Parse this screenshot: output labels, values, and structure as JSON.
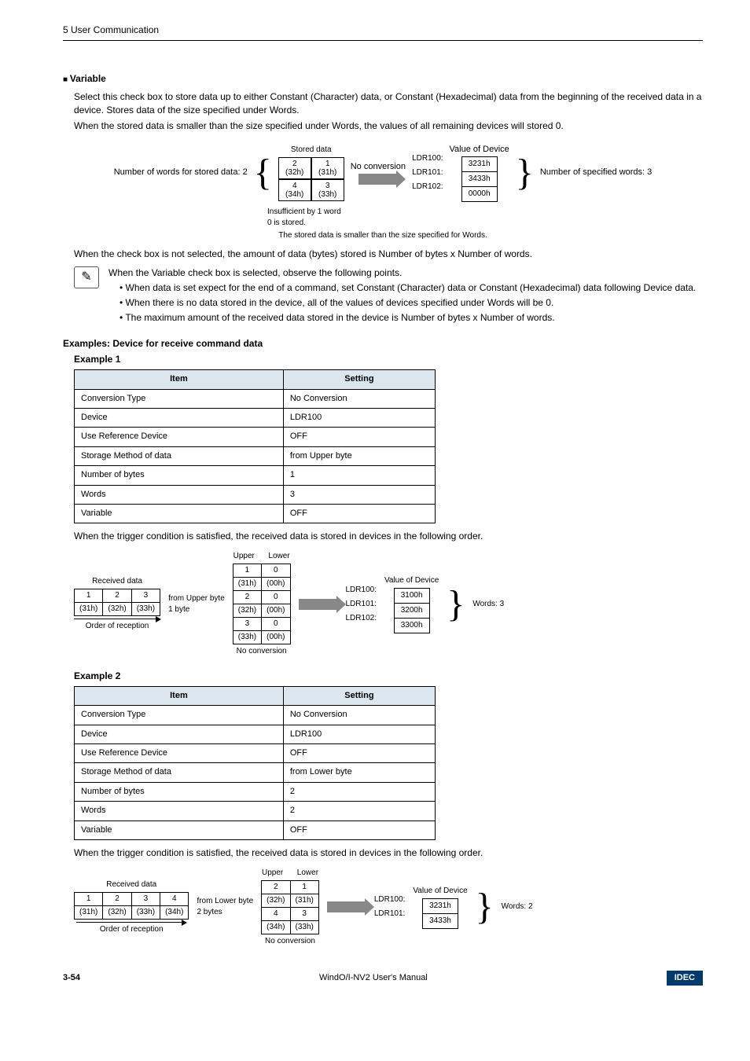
{
  "header": {
    "chapter": "5 User Communication"
  },
  "section": {
    "title": "Variable",
    "para1": "Select this check box to store data up to either Constant (Character) data, or Constant (Hexadecimal) data from the beginning of the received data in a device. Stores data of the size specified under Words.",
    "para2": "When the stored data is smaller than the size specified under Words, the values of all remaining devices will stored 0."
  },
  "figure1": {
    "lead_label": "Number of words for stored data: 2",
    "stored_data_label": "Stored data",
    "cells": [
      {
        "n": "2",
        "h": "(32h)"
      },
      {
        "n": "1",
        "h": "(31h)"
      },
      {
        "n": "4",
        "h": "(34h)"
      },
      {
        "n": "3",
        "h": "(33h)"
      }
    ],
    "no_conversion": "No conversion",
    "value_of_device": "Value of Device",
    "devices": [
      "LDR100:",
      "LDR101:",
      "LDR102:"
    ],
    "values": [
      "3231h",
      "3433h",
      "0000h"
    ],
    "trail_label": "Number of specified words: 3",
    "note1": "Insufficient by 1 word\n0 is stored.",
    "note2": "The stored data is smaller than the size specified for Words."
  },
  "after_fig1": "When the check box is not selected, the amount of data (bytes) stored is Number of bytes x Number of words.",
  "info": {
    "intro": "When the Variable check box is selected, observe the following points.",
    "bullets": [
      "When data is set expect for the end of a command, set Constant (Character) data or Constant (Hexadecimal) data following Device data.",
      "When there is no data stored in the device, all of the values of devices specified under Words will be 0.",
      "The maximum amount of the received data stored in the device is Number of bytes x Number of words."
    ]
  },
  "examples_title": "Examples: Device for receive command data",
  "example1": {
    "title": "Example 1",
    "headers": [
      "Item",
      "Setting"
    ],
    "rows": [
      [
        "Conversion Type",
        "No Conversion"
      ],
      [
        "Device",
        "LDR100"
      ],
      [
        "Use Reference Device",
        "OFF"
      ],
      [
        "Storage Method of data",
        "from Upper byte"
      ],
      [
        "Number of bytes",
        "1"
      ],
      [
        "Words",
        "3"
      ],
      [
        "Variable",
        "OFF"
      ]
    ],
    "caption": "When the trigger condition is satisfied, the received data is stored in devices in the following order.",
    "fig": {
      "received_label": "Received data",
      "recv_indices": [
        "1",
        "2",
        "3"
      ],
      "recv_hex": [
        "(31h)",
        "(32h)",
        "(33h)"
      ],
      "order_label": "Order of reception",
      "method": "from Upper byte\n1 byte",
      "upper": "Upper",
      "lower": "Lower",
      "pairs": [
        [
          "1",
          "0",
          "(31h)",
          "(00h)"
        ],
        [
          "2",
          "0",
          "(32h)",
          "(00h)"
        ],
        [
          "3",
          "0",
          "(33h)",
          "(00h)"
        ]
      ],
      "no_conv": "No conversion",
      "value_label": "Value of Device",
      "devices": [
        "LDR100:",
        "LDR101:",
        "LDR102:"
      ],
      "values": [
        "3100h",
        "3200h",
        "3300h"
      ],
      "words": "Words: 3"
    }
  },
  "example2": {
    "title": "Example 2",
    "headers": [
      "Item",
      "Setting"
    ],
    "rows": [
      [
        "Conversion Type",
        "No Conversion"
      ],
      [
        "Device",
        "LDR100"
      ],
      [
        "Use Reference Device",
        "OFF"
      ],
      [
        "Storage Method of data",
        "from Lower byte"
      ],
      [
        "Number of bytes",
        "2"
      ],
      [
        "Words",
        "2"
      ],
      [
        "Variable",
        "OFF"
      ]
    ],
    "caption": "When the trigger condition is satisfied, the received data is stored in devices in the following order.",
    "fig": {
      "received_label": "Received data",
      "recv_indices": [
        "1",
        "2",
        "3",
        "4"
      ],
      "recv_hex": [
        "(31h)",
        "(32h)",
        "(33h)",
        "(34h)"
      ],
      "order_label": "Order of reception",
      "method": "from Lower byte\n2 bytes",
      "upper": "Upper",
      "lower": "Lower",
      "pairs": [
        [
          "2",
          "1",
          "(32h)",
          "(31h)"
        ],
        [
          "4",
          "3",
          "(34h)",
          "(33h)"
        ]
      ],
      "no_conv": "No conversion",
      "value_label": "Value of Device",
      "devices": [
        "LDR100:",
        "LDR101:"
      ],
      "values": [
        "3231h",
        "3433h"
      ],
      "words": "Words: 2"
    }
  },
  "footer": {
    "page": "3-54",
    "manual": "WindO/I-NV2 User's Manual",
    "brand": "IDEC"
  }
}
